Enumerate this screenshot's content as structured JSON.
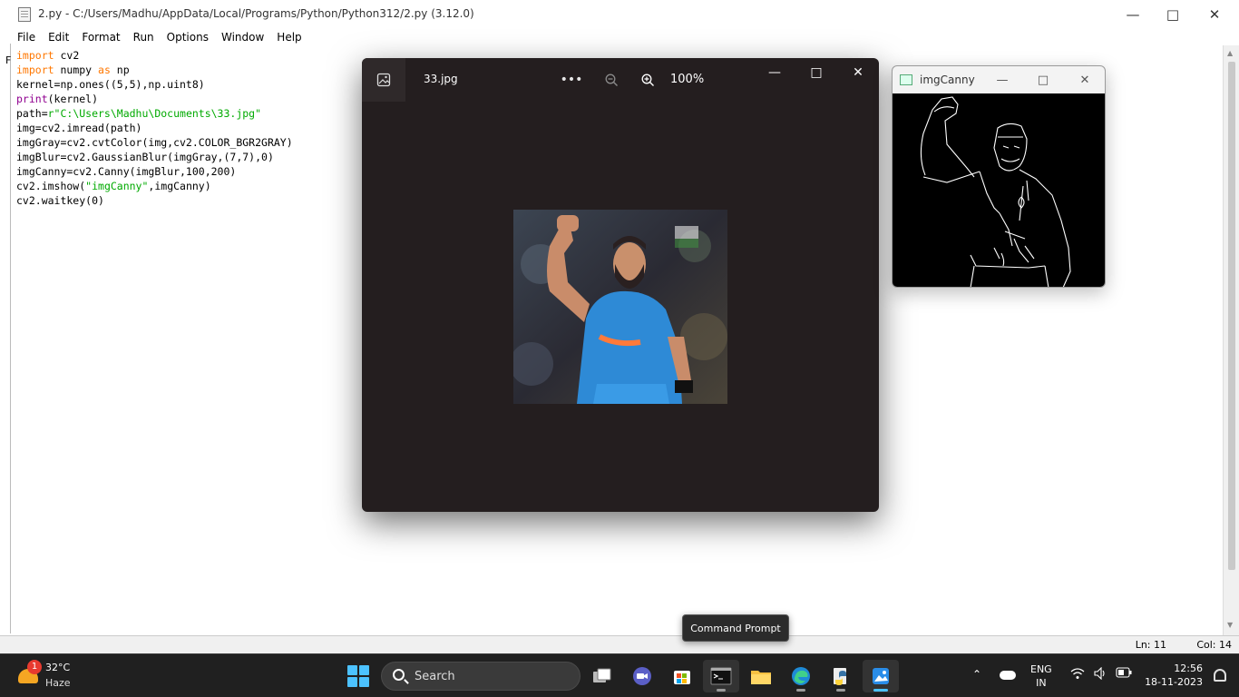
{
  "idle": {
    "title": "2.py - C:/Users/Madhu/AppData/Local/Programs/Python/Python312/2.py (3.12.0)",
    "menu": [
      "File",
      "Edit",
      "Format",
      "Run",
      "Options",
      "Window",
      "Help"
    ],
    "edge_letter": "F",
    "code": {
      "l1_kw": "import",
      "l1_rest": " cv2",
      "l2_kw": "import",
      "l2_mid": " numpy ",
      "l2_kw2": "as",
      "l2_rest": " np",
      "l3": "kernel=np.ones((5,5),np.uint8)",
      "l4_bi": "print",
      "l4_rest": "(kernel)",
      "l5_a": "path=",
      "l5_str": "r\"C:\\Users\\Madhu\\Documents\\33.jpg\"",
      "l6": "img=cv2.imread(path)",
      "l7": "imgGray=cv2.cvtColor(img,cv2.COLOR_BGR2GRAY)",
      "l8": "imgBlur=cv2.GaussianBlur(imgGray,(7,7),0)",
      "l9": "imgCanny=cv2.Canny(imgBlur,100,200)",
      "l10_a": "cv2.imshow(",
      "l10_str": "\"imgCanny\"",
      "l10_b": ",imgCanny)",
      "l11": "cv2.waitkey(0)"
    },
    "status": {
      "line": "Ln: 11",
      "col": "Col: 14"
    }
  },
  "photos": {
    "filename": "33.jpg",
    "zoom": "100%",
    "more_glyph": "•••"
  },
  "canny": {
    "title": "imgCanny"
  },
  "tooltip": "Command Prompt",
  "taskbar": {
    "weather_badge": "1",
    "temperature": "32°C",
    "condition": "Haze",
    "search_label": "Search",
    "lang_top": "ENG",
    "lang_bottom": "IN",
    "time": "12:56",
    "date": "18-11-2023"
  },
  "colors": {
    "keyword": "#ff7700",
    "builtin": "#900090",
    "string": "#00aa00",
    "viewer_bg": "#241e1f",
    "taskbar_bg": "#202020",
    "accent": "#4cc2ff"
  }
}
